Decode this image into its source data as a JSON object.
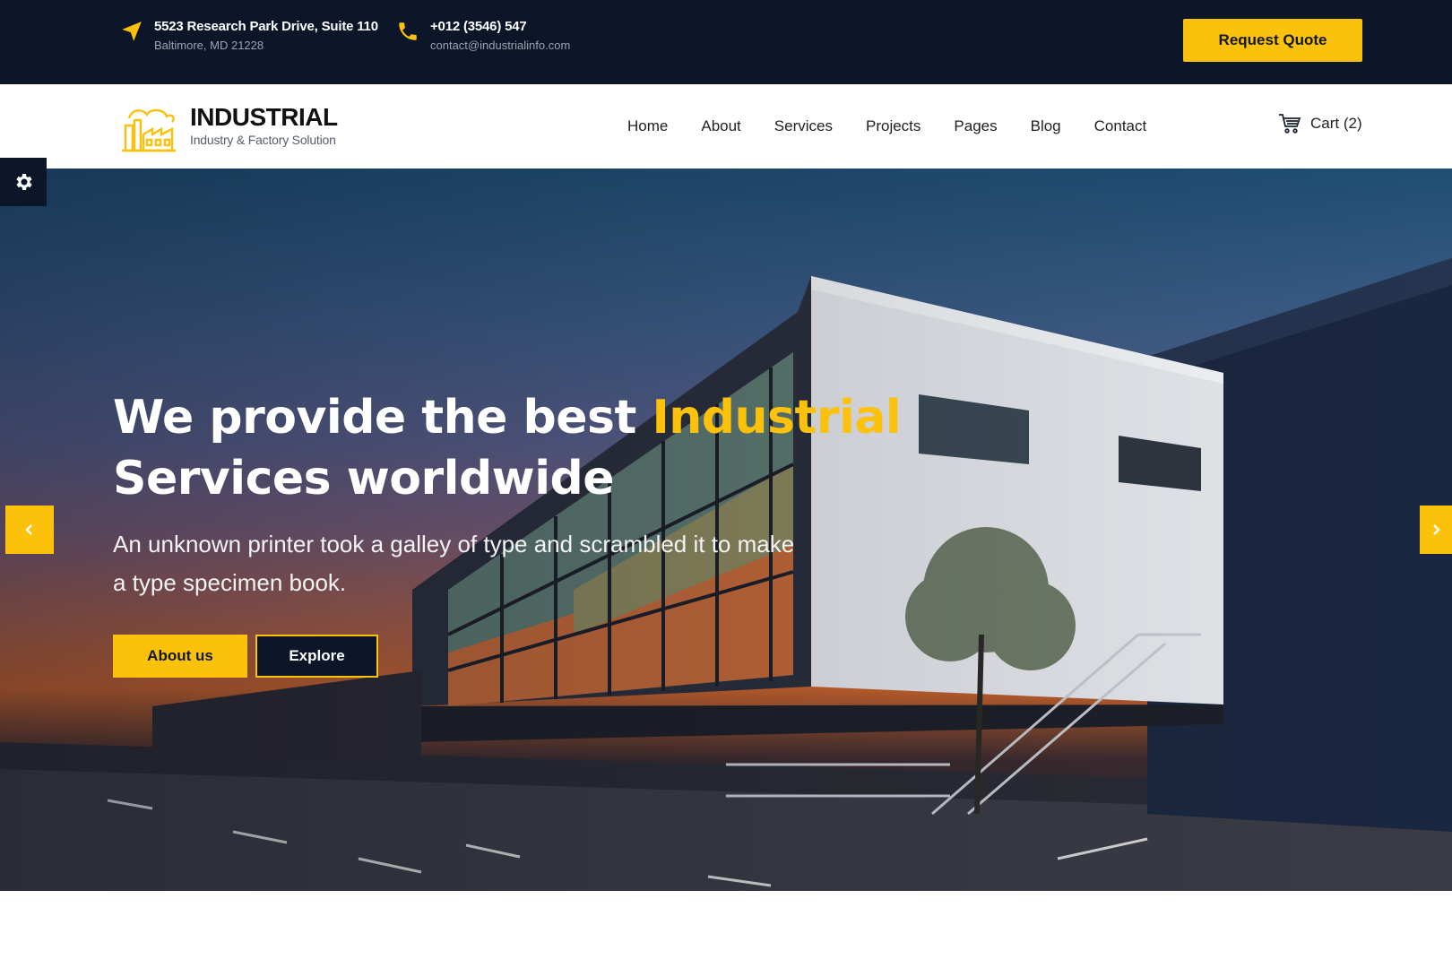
{
  "topbar": {
    "address": {
      "line1": "5523 Research Park Drive, Suite 110",
      "line2": "Baltimore, MD 21228",
      "icon": "location-arrow-icon"
    },
    "contact": {
      "line1": "+012 (3546) 547",
      "line2": "contact@industrialinfo.com",
      "icon": "phone-icon"
    },
    "quote_button": "Request Quote"
  },
  "brand": {
    "name": "INDUSTRIAL",
    "tagline": "Industry & Factory Solution",
    "icon": "factory-logo-icon"
  },
  "nav": {
    "items": [
      "Home",
      "About",
      "Services",
      "Projects",
      "Pages",
      "Blog",
      "Contact"
    ],
    "cart_label": "Cart (2)"
  },
  "hero": {
    "title_before": "We provide the best ",
    "title_highlight": "Industrial",
    "title_after": "Services worldwide",
    "subtitle": "An unknown printer took a galley of type and scrambled it to make a type specimen book.",
    "primary_button": "About us",
    "secondary_button": "Explore"
  },
  "colors": {
    "accent": "#fcc10a",
    "dark": "#0c1628",
    "white": "#ffffff"
  }
}
